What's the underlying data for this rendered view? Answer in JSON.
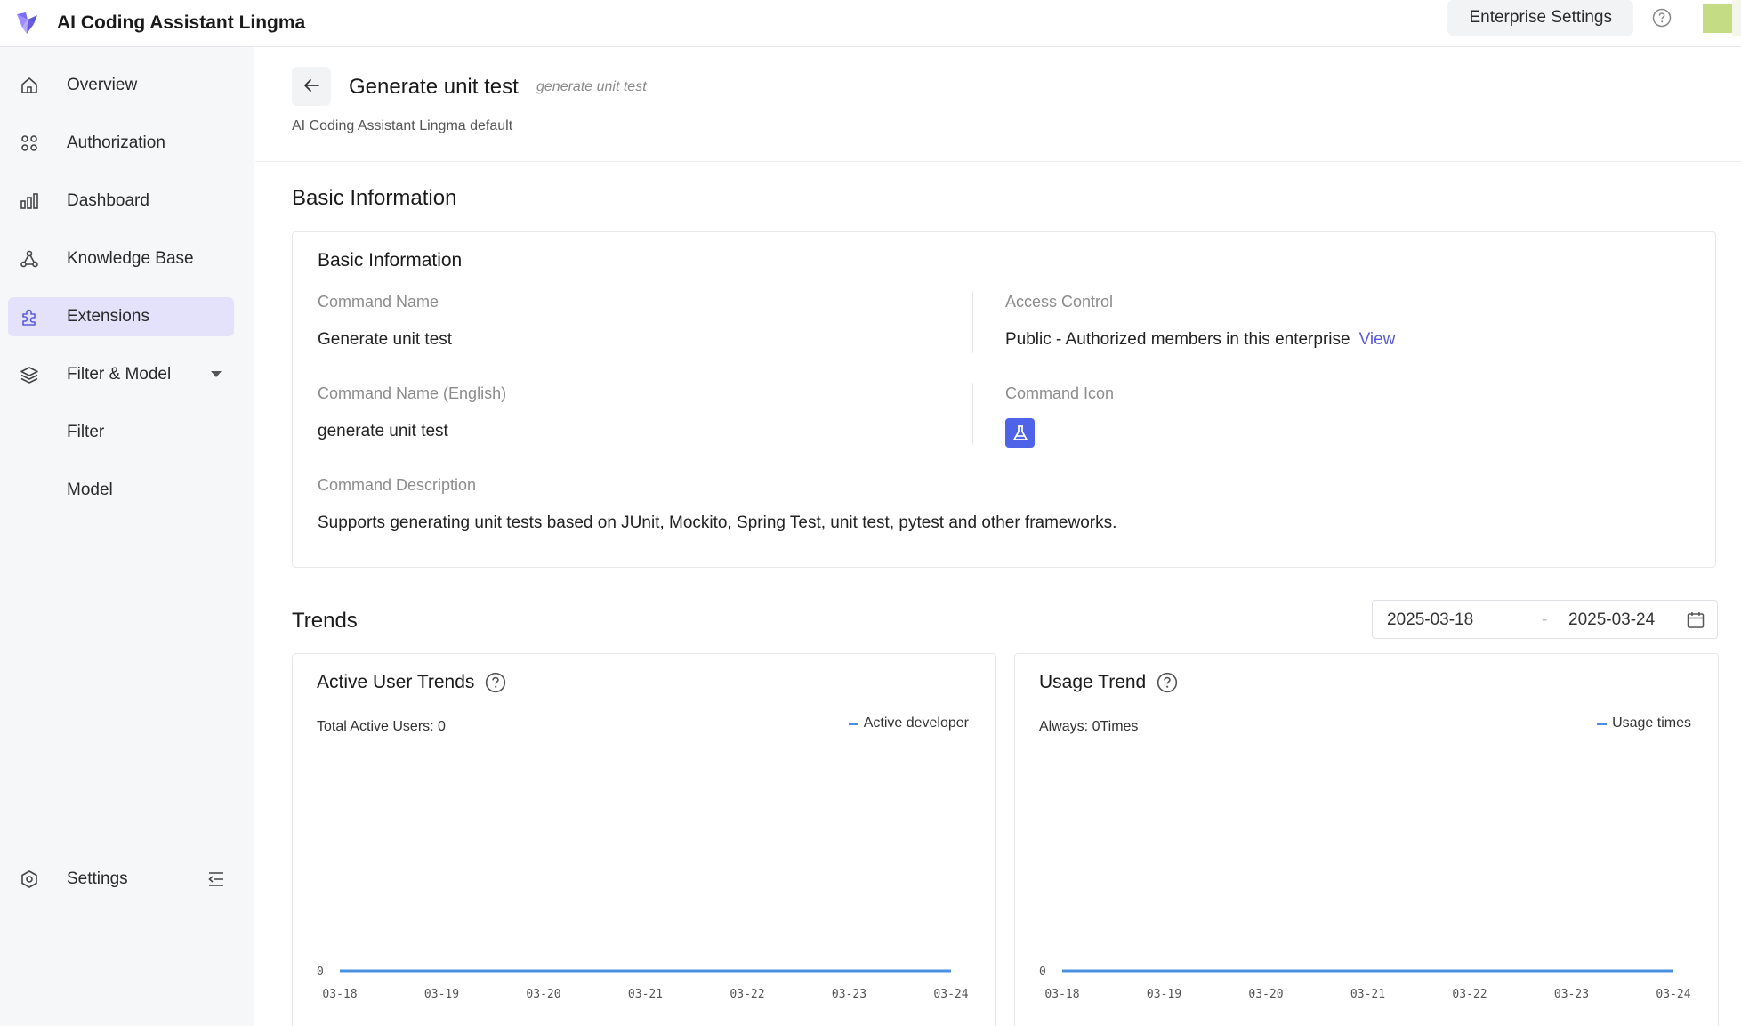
{
  "app": {
    "title": "AI Coding Assistant Lingma"
  },
  "topbar": {
    "enterprise_settings": "Enterprise Settings"
  },
  "sidebar": {
    "items": [
      {
        "label": "Overview",
        "icon": "home-icon"
      },
      {
        "label": "Authorization",
        "icon": "grid-icon"
      },
      {
        "label": "Dashboard",
        "icon": "bar-chart-icon"
      },
      {
        "label": "Knowledge Base",
        "icon": "nodes-icon"
      },
      {
        "label": "Extensions",
        "icon": "puzzle-icon",
        "active": true
      },
      {
        "label": "Filter & Model",
        "icon": "layers-icon"
      },
      {
        "label": "Filter"
      },
      {
        "label": "Model"
      }
    ],
    "settings": "Settings"
  },
  "header": {
    "title": "Generate unit test",
    "subtitle": "generate unit test",
    "meta": "AI Coding Assistant Lingma default"
  },
  "basic": {
    "section_title": "Basic Information",
    "card_title": "Basic Information",
    "command_name_label": "Command Name",
    "command_name": "Generate unit test",
    "access_control_label": "Access Control",
    "access_control": "Public - Authorized members in this enterprise",
    "view_link": "View",
    "command_name_en_label": "Command Name (English)",
    "command_name_en": "generate unit test",
    "command_icon_label": "Command Icon",
    "command_description_label": "Command Description",
    "command_description": "Supports generating unit tests based on JUnit, Mockito, Spring Test, unit test, pytest and other frameworks."
  },
  "trends": {
    "section_title": "Trends",
    "date_start": "2025-03-18",
    "date_sep": "-",
    "date_end": "2025-03-24"
  },
  "charts": {
    "active": {
      "title": "Active User Trends",
      "summary": "Total Active Users: 0",
      "legend": "Active developer"
    },
    "usage": {
      "title": "Usage Trend",
      "summary": "Always: 0Times",
      "legend": "Usage times"
    }
  },
  "colors": {
    "accent": "#5b5bd6",
    "active_bg": "#e4e2fb",
    "line": "#4a90e2",
    "icon_bg": "#4f63e8"
  },
  "chart_data": [
    {
      "type": "line",
      "title": "Active User Trends",
      "categories": [
        "03-18",
        "03-19",
        "03-20",
        "03-21",
        "03-22",
        "03-23",
        "03-24"
      ],
      "series": [
        {
          "name": "Active developer",
          "values": [
            0,
            0,
            0,
            0,
            0,
            0,
            0
          ]
        }
      ],
      "yticks": [
        "0"
      ],
      "legend": "top-right",
      "grid": false
    },
    {
      "type": "line",
      "title": "Usage Trend",
      "categories": [
        "03-18",
        "03-19",
        "03-20",
        "03-21",
        "03-22",
        "03-23",
        "03-24"
      ],
      "series": [
        {
          "name": "Usage times",
          "values": [
            0,
            0,
            0,
            0,
            0,
            0,
            0
          ]
        }
      ],
      "yticks": [
        "0"
      ],
      "legend": "top-right",
      "grid": false
    }
  ]
}
